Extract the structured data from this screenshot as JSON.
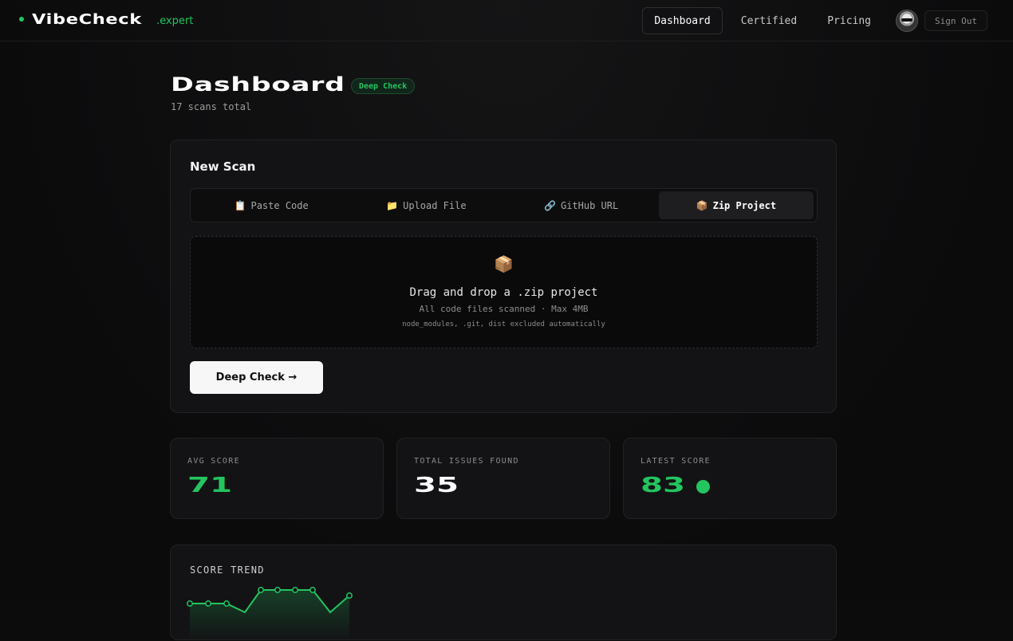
{
  "brand": {
    "name": "VibeCheck",
    "suffix": ".expert",
    "accent": "#22c55e"
  },
  "nav": {
    "items": [
      {
        "label": "Dashboard",
        "active": true
      },
      {
        "label": "Certified",
        "active": false
      },
      {
        "label": "Pricing",
        "active": false
      }
    ],
    "signout_label": "Sign Out"
  },
  "page": {
    "title": "Dashboard",
    "badge": "Deep Check",
    "subtitle": "17 scans total"
  },
  "new_scan": {
    "title": "New Scan",
    "tabs": [
      {
        "icon": "📋",
        "icon_name": "clipboard-icon",
        "label": "Paste Code",
        "active": false
      },
      {
        "icon": "📁",
        "icon_name": "folder-icon",
        "label": "Upload File",
        "active": false
      },
      {
        "icon": "🔗",
        "icon_name": "link-icon",
        "label": "GitHub URL",
        "active": false
      },
      {
        "icon": "📦",
        "icon_name": "package-icon",
        "label": "Zip Project",
        "active": true
      }
    ],
    "dropzone": {
      "icon": "📦",
      "title": "Drag and drop a .zip project",
      "subtitle": "All code files scanned · Max 4MB",
      "note": "node_modules, .git, dist excluded automatically"
    },
    "cta_label": "Deep Check →"
  },
  "stats": [
    {
      "label": "AVG SCORE",
      "value": "71",
      "color": "#22c55e"
    },
    {
      "label": "TOTAL ISSUES FOUND",
      "value": "35",
      "color": "#ffffff"
    },
    {
      "label": "LATEST SCORE",
      "value": "83",
      "color": "#22c55e",
      "status_dot": "#22c55e"
    }
  ],
  "score_trend": {
    "label": "SCORE TREND"
  }
}
